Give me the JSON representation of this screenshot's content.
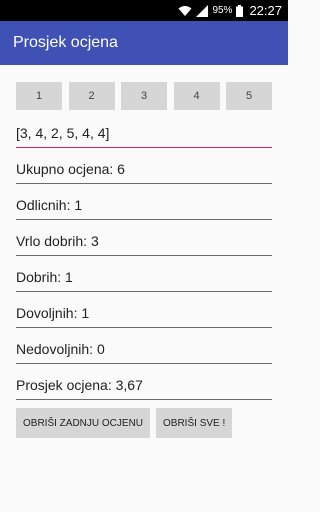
{
  "status_bar": {
    "battery": "95%",
    "time": "22:27",
    "icons": [
      "wifi-icon",
      "signal-icon",
      "battery-icon"
    ]
  },
  "app_bar": {
    "title": "Prosjek ocjena",
    "color": "#3f51b5"
  },
  "grade_buttons": [
    "1",
    "2",
    "3",
    "4",
    "5"
  ],
  "grades_list": "[3, 4, 2, 5, 4, 4]",
  "stats": {
    "ukupno": "Ukupno ocjena: 6",
    "odlicnih": "Odlicnih: 1",
    "vrlo_dobrih": "Vrlo dobrih: 3",
    "dobrih": "Dobrih: 1",
    "dovoljnih": "Dovoljnih: 1",
    "nedovoljnih": "Nedovoljnih: 0",
    "prosjek": "Prosjek ocjena: 3,67"
  },
  "actions": {
    "delete_last": "OBRIŠI ZADNJU OCJENU",
    "delete_all": "OBRIŠI SVE !"
  },
  "accent_color": "#e91e63"
}
